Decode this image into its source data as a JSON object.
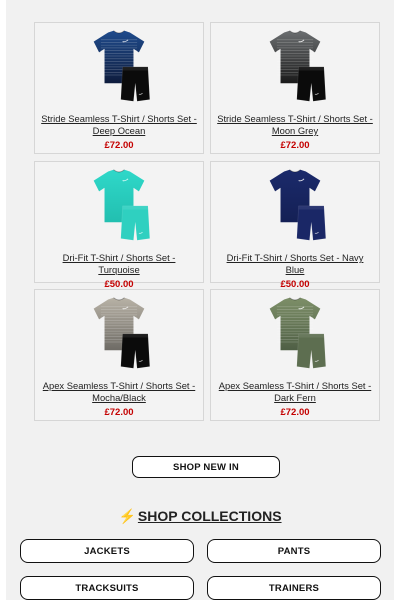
{
  "products": [
    {
      "name": "Stride Seamless T-Shirt / Shorts Set - Deep Ocean",
      "price": "£72.00",
      "colors": {
        "shirt": "#1f4b8c",
        "shirt_dark": "#0e1c3d",
        "shorts": "#0b0b0b",
        "pattern": "seamless"
      }
    },
    {
      "name": "Stride Seamless T-Shirt / Shorts Set - Moon Grey",
      "price": "£72.00",
      "colors": {
        "shirt": "#6b6e70",
        "shirt_dark": "#1a1a1a",
        "shorts": "#0b0b0b",
        "pattern": "seamless"
      }
    },
    {
      "name": "Dri-Fit T-Shirt / Shorts Set - Turquoise",
      "price": "£50.00",
      "colors": {
        "shirt": "#2fd8c9",
        "shirt_dark": "#22bfb0",
        "shorts": "#2fd0c0",
        "pattern": "plain"
      }
    },
    {
      "name": "Dri-Fit T-Shirt / Shorts Set - Navy Blue",
      "price": "£50.00",
      "colors": {
        "shirt": "#1b2a6b",
        "shirt_dark": "#142055",
        "shorts": "#1a2766",
        "pattern": "plain"
      }
    },
    {
      "name": "Apex Seamless T-Shirt / Shorts Set - Mocha/Black",
      "price": "£72.00",
      "colors": {
        "shirt": "#b8b2a6",
        "shirt_dark": "#6e6b65",
        "shorts": "#0b0b0b",
        "pattern": "seamless"
      }
    },
    {
      "name": "Apex Seamless T-Shirt / Shorts Set - Dark Fern",
      "price": "£72.00",
      "colors": {
        "shirt": "#7d8f68",
        "shirt_dark": "#4f5f45",
        "shorts": "#5d6e50",
        "pattern": "seamless"
      }
    }
  ],
  "shop_new_in": "SHOP NEW IN",
  "collections": {
    "icon": "lightning-bolt-icon",
    "title": "SHOP COLLECTIONS",
    "buttons": [
      "JACKETS",
      "PANTS",
      "TRACKSUITS",
      "TRAINERS"
    ]
  },
  "theme": {
    "price_color": "#c40000",
    "background": "#f1f1f1"
  }
}
